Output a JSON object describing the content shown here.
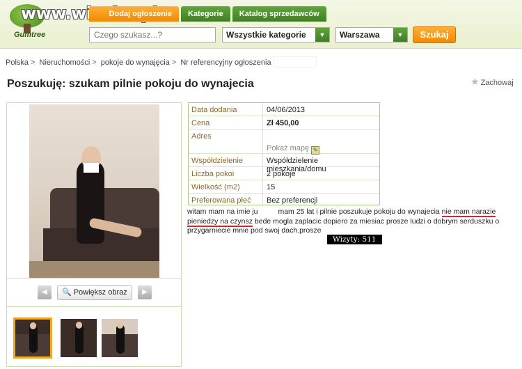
{
  "watermark": "www.wiocha.pl",
  "logo": {
    "brand": "Gumtree"
  },
  "tabs": [
    {
      "label": "Dodaj ogłoszenie",
      "style": "orange"
    },
    {
      "label": "Kategorie",
      "style": "green"
    },
    {
      "label": "Katalog sprzedawców",
      "style": "green"
    }
  ],
  "search": {
    "placeholder": "Czego szukasz...?",
    "category": "Wszystkie kategorie",
    "city": "Warszawa",
    "button": "Szukaj"
  },
  "breadcrumb": [
    "Polska",
    "Nieruchomości",
    "pokoje do wynajęcia",
    "Nr referencyjny ogłoszenia"
  ],
  "title": "Poszukuję: szukam pilnie pokoju do wynajecia",
  "save_label": "Zachowaj",
  "image_controls": {
    "zoom": "Powiększ obraz"
  },
  "details": [
    {
      "label": "Data dodania",
      "value": "04/06/2013"
    },
    {
      "label": "Cena",
      "value": "Zł  450,00"
    },
    {
      "label": "Adres",
      "value": "",
      "map_link": "Pokaż mapę"
    },
    {
      "label": "Współdzielenie",
      "value": "Współdzielenie mieszkania/domu"
    },
    {
      "label": "Liczba pokoi",
      "value": "2 pokoje"
    },
    {
      "label": "Wielkość (m2)",
      "value": "15"
    },
    {
      "label": "Preferowana płeć",
      "value": "Bez preferencji"
    }
  ],
  "description": {
    "p1": "witam mam na imie ju",
    "p2": "mam 25 lat i pilnie poszukuje pokoju do wynajecia ",
    "u1": "nie mam narazie",
    "u2": "pieniedzy na czynsz",
    "p3": " bede mogla zaplacic dopiero za miesiac prosze ludzi o dobrym serduszku o przygarniecie mnie pod swoj dach.prosze"
  },
  "visits": "Wizyty: 511",
  "colors": {
    "accent_orange": "#f08a00",
    "accent_green": "#3f7f22",
    "label_brown": "#8a6a2c",
    "underline_red": "#e0202a"
  }
}
